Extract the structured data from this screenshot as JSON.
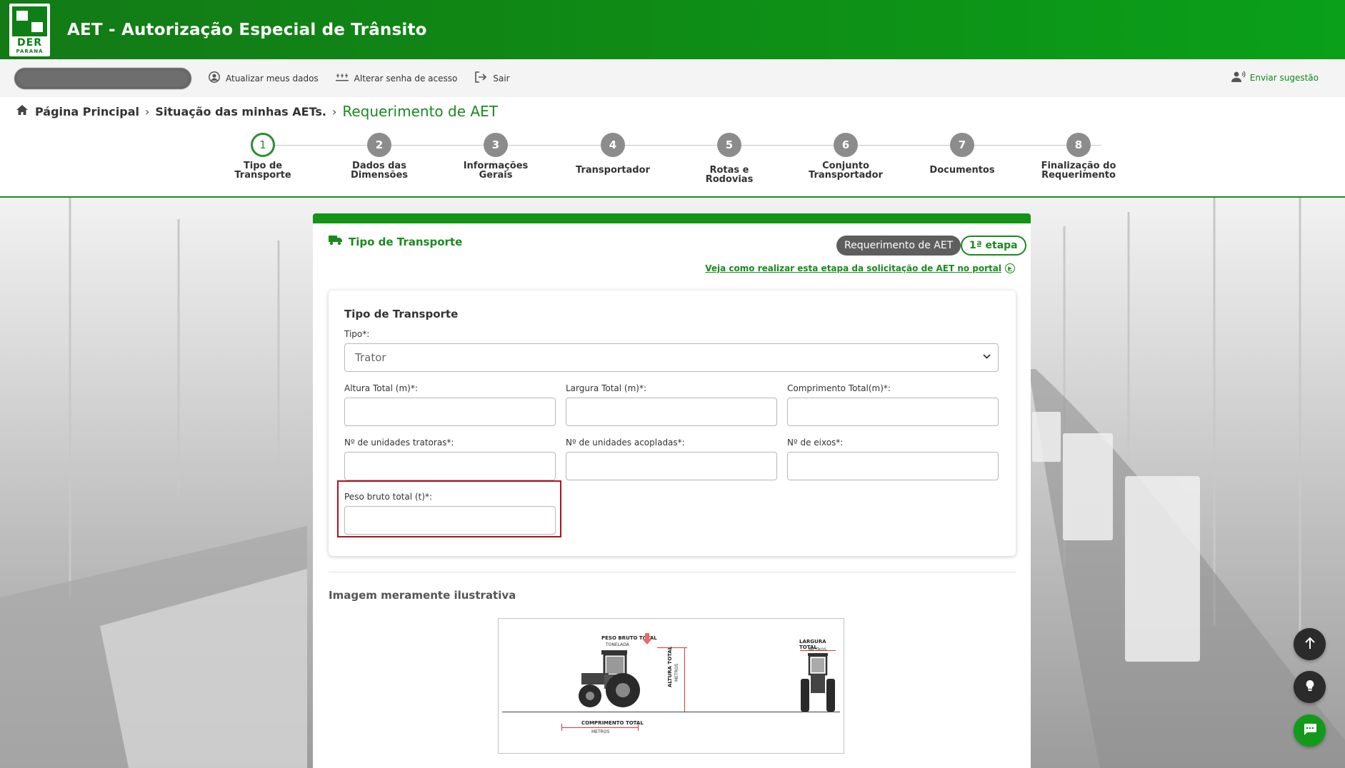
{
  "header": {
    "logo_text": "DER",
    "logo_subtext": "PARANÁ",
    "title": "AET - Autorização Especial de Trânsito"
  },
  "userbar": {
    "update_label": "Atualizar meus dados",
    "password_label": "Alterar senha de acesso",
    "logout_label": "Sair",
    "suggestion_label": "Enviar sugestão"
  },
  "breadcrumb": {
    "home": "Página Principal",
    "second": "Situação das minhas AETs.",
    "current": "Requerimento de AET"
  },
  "steps": [
    {
      "num": "1",
      "label": "Tipo de Transporte"
    },
    {
      "num": "2",
      "label": "Dados das Dimensões"
    },
    {
      "num": "3",
      "label": "Informações Gerais"
    },
    {
      "num": "4",
      "label": "Transportador"
    },
    {
      "num": "5",
      "label": "Rotas e Rodovias"
    },
    {
      "num": "6",
      "label": "Conjunto Transportador"
    },
    {
      "num": "7",
      "label": "Documentos"
    },
    {
      "num": "8",
      "label": "Finalização do Requerimento"
    }
  ],
  "section": {
    "title": "Tipo de Transporte",
    "badge": "Requerimento de AET",
    "stage": "1ª etapa",
    "help_link": "Veja como realizar esta etapa da solicitação de AET no portal"
  },
  "form": {
    "title": "Tipo de Transporte",
    "tipo_label": "Tipo*:",
    "tipo_value": "Trator",
    "altura_label": "Altura Total (m)*:",
    "largura_label": "Largura Total (m)*:",
    "comprimento_label": "Comprimento Total(m)*:",
    "tratoras_label": "Nº de unidades tratoras*:",
    "acopladas_label": "Nº de unidades acopladas*:",
    "eixos_label": "Nº de eixos*:",
    "peso_label": "Peso bruto total (t)*:"
  },
  "illustration": {
    "title": "Imagem meramente ilustrativa",
    "peso_title": "PESO BRUTO TOTAL",
    "peso_unit": "TONELADA",
    "altura_title": "ALTURA TOTAL",
    "altura_unit": "METROS",
    "largura_title": "LARGURA TOTAL",
    "largura_unit": "METROS",
    "comprimento_title": "COMPRIMENTO TOTAL",
    "comprimento_unit": "METROS"
  },
  "colors": {
    "brand_green": "#129418",
    "active_step": "#2a8f2e",
    "highlight_red": "#b0121b"
  }
}
